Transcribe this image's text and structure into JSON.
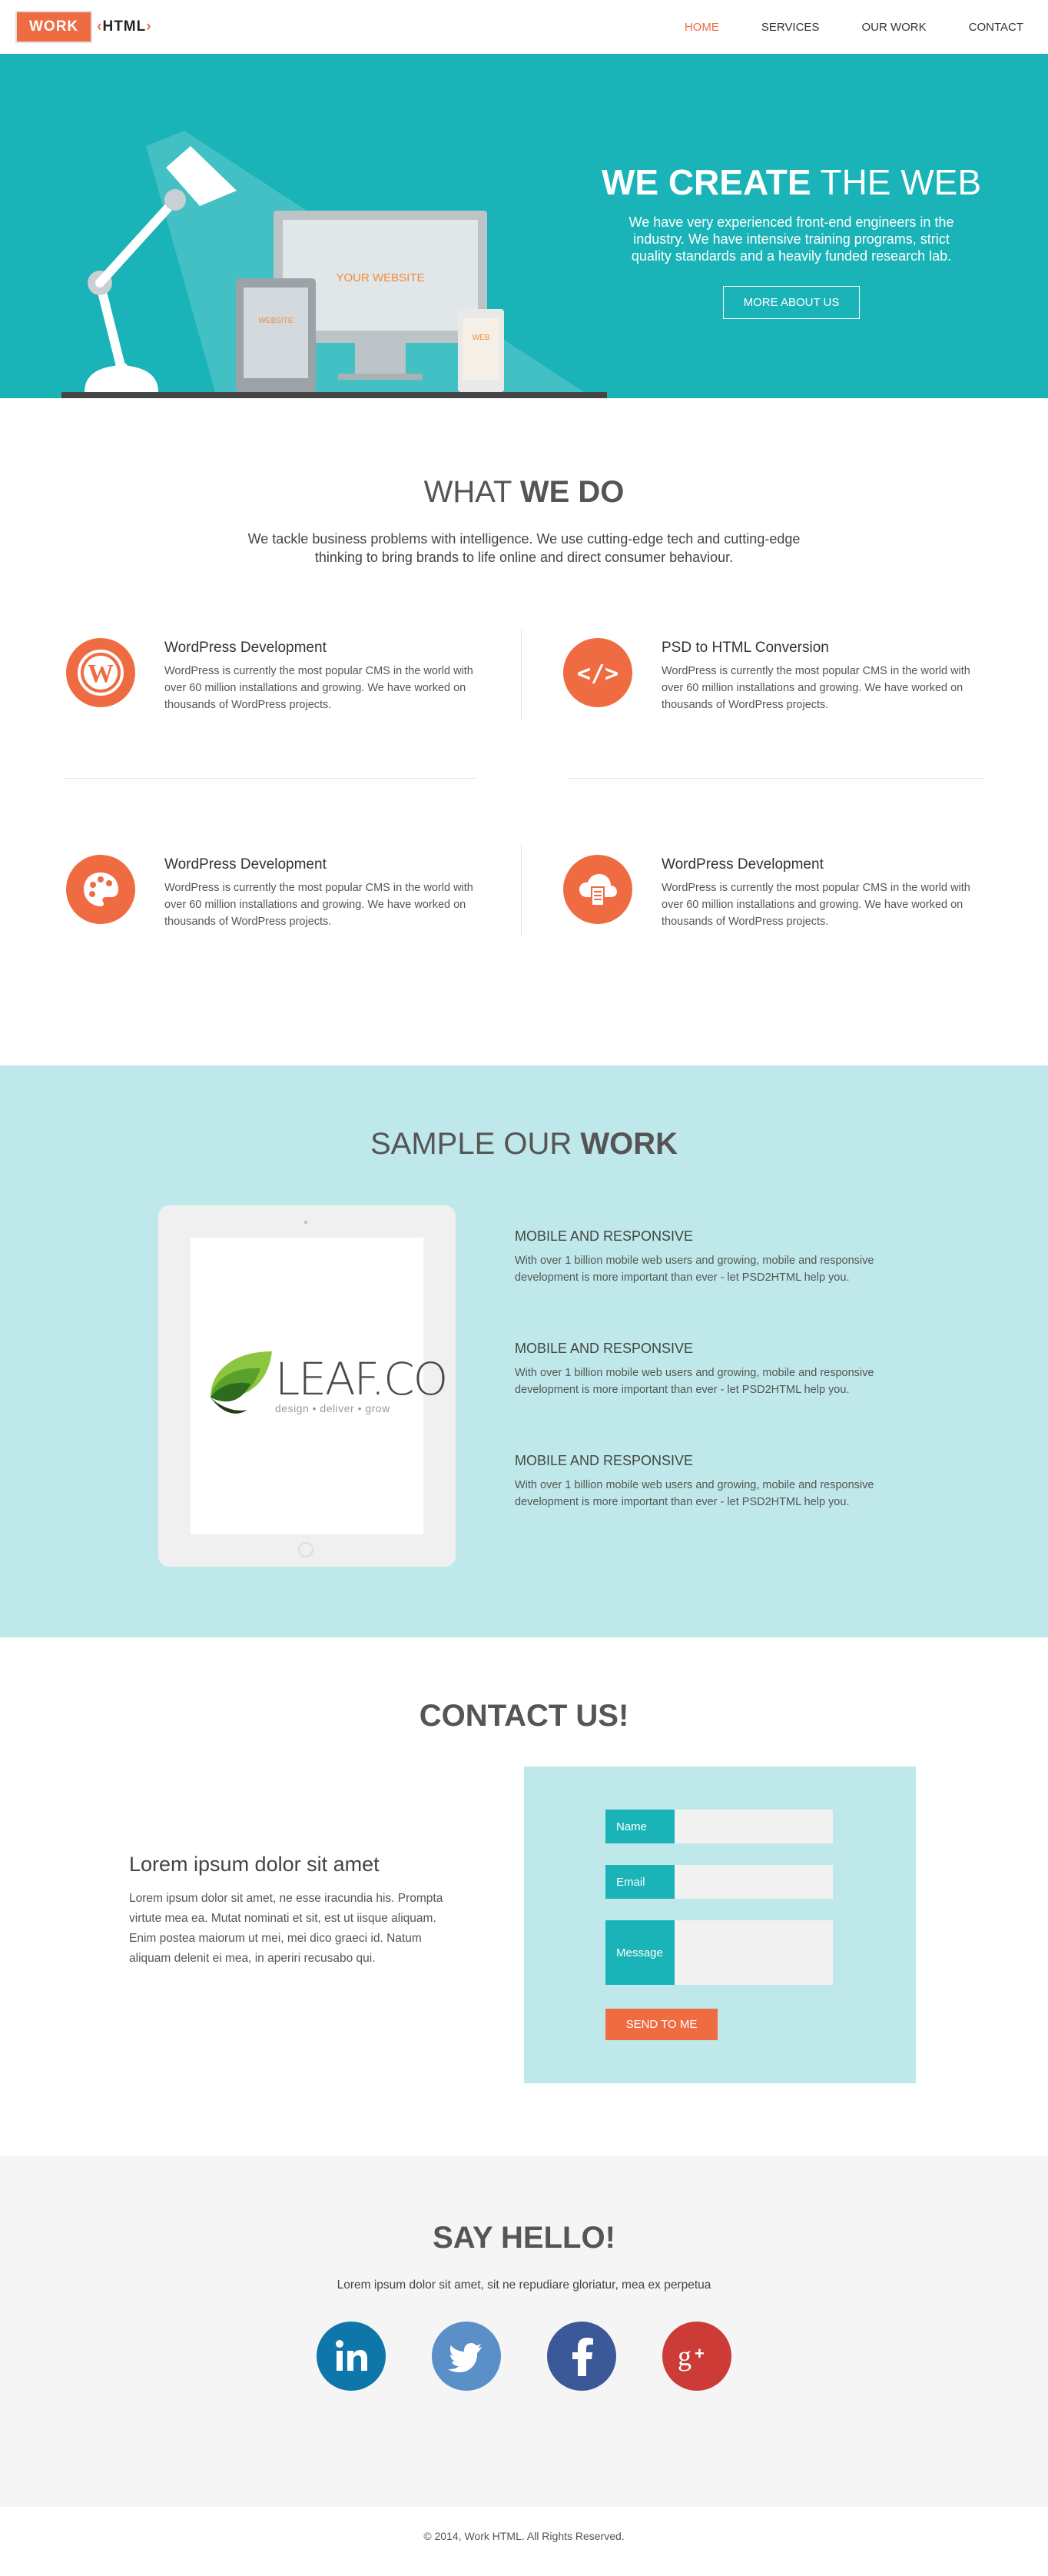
{
  "nav": {
    "logo_work": "WORK",
    "logo_html": "HTML",
    "items": [
      {
        "label": "HOME",
        "active": true
      },
      {
        "label": "SERVICES",
        "active": false
      },
      {
        "label": "OUR WORK",
        "active": false
      },
      {
        "label": "CONTACT",
        "active": false
      }
    ]
  },
  "hero": {
    "title_bold": "WE CREATE",
    "title_light": " THE WEB",
    "description": "We have very experienced front-end engineers in the industry. We have intensive training programs, strict quality standards and a heavily funded research lab.",
    "button": "MORE ABOUT US",
    "monitor_label": "YOUR WEBSITE",
    "tablet_label": "WEBSITE",
    "phone_label": "WEB"
  },
  "services": {
    "title_light": "WHAT ",
    "title_bold": "WE DO",
    "lead": "We tackle business problems with intelligence. We use cutting-edge tech and cutting-edge thinking to bring brands to life online and direct consumer behaviour.",
    "items": [
      {
        "icon": "wordpress-icon",
        "title": "WordPress Development",
        "text": "WordPress is currently the most popular CMS in the world with over 60 million installations and growing. We have worked on thousands of WordPress projects."
      },
      {
        "icon": "code-icon",
        "title": "PSD to HTML Conversion",
        "text": "WordPress is currently the most popular CMS in the world with over 60 million installations and growing. We have worked on thousands of WordPress projects."
      },
      {
        "icon": "palette-icon",
        "title": "WordPress Development",
        "text": "WordPress is currently the most popular CMS in the world with over 60 million installations and growing. We have worked on thousands of WordPress projects."
      },
      {
        "icon": "cloud-document-icon",
        "title": "WordPress Development",
        "text": "WordPress is currently the most popular CMS in the world with over 60 million installations and growing. We have worked on thousands of WordPress projects."
      }
    ]
  },
  "work": {
    "title_light": "SAMPLE OUR ",
    "title_bold": "WORK",
    "logo_name": "LEAF.CO",
    "logo_tagline": "design • deliver • grow",
    "items": [
      {
        "title": "MOBILE AND RESPONSIVE",
        "text": "With over 1 billion mobile web users and growing, mobile and responsive development is more important than ever - let PSD2HTML help you."
      },
      {
        "title": "MOBILE AND RESPONSIVE",
        "text": "With over 1 billion mobile web users and growing, mobile and responsive development is more important than ever - let PSD2HTML help you."
      },
      {
        "title": "MOBILE AND RESPONSIVE",
        "text": "With over 1 billion mobile web users and growing, mobile and responsive development is more important than ever - let PSD2HTML help you."
      }
    ]
  },
  "contact": {
    "title": "CONTACT US!",
    "heading": "Lorem ipsum dolor sit amet",
    "text": "Lorem ipsum dolor sit amet, ne esse iracundia his. Prompta virtute mea ea. Mutat nominati et sit, est ut iisque aliquam. Enim postea maiorum ut mei, mei dico graeci id. Natum aliquam delenit ei mea, in aperiri recusabo qui.",
    "form": {
      "name_label": "Name",
      "name_value": "",
      "email_label": "Email",
      "email_value": "",
      "message_label": "Message",
      "message_value": "",
      "send_button": "SEND TO ME"
    }
  },
  "hello": {
    "title": "SAY HELLO!",
    "lead": "Lorem ipsum dolor sit amet, sit ne repudiare gloriatur, mea ex perpetua",
    "socials": [
      {
        "icon": "linkedin-icon",
        "color": "#0e76a8"
      },
      {
        "icon": "twitter-icon",
        "color": "#5a8fc8"
      },
      {
        "icon": "facebook-icon",
        "color": "#3b5998"
      },
      {
        "icon": "google-plus-icon",
        "color": "#cc3b36"
      }
    ]
  },
  "footer": {
    "copyright": "© 2014, Work HTML. All Rights Reserved."
  },
  "colors": {
    "accent": "#ef6c43",
    "teal": "#1ab3b8",
    "light_teal": "#bfe8ea"
  }
}
